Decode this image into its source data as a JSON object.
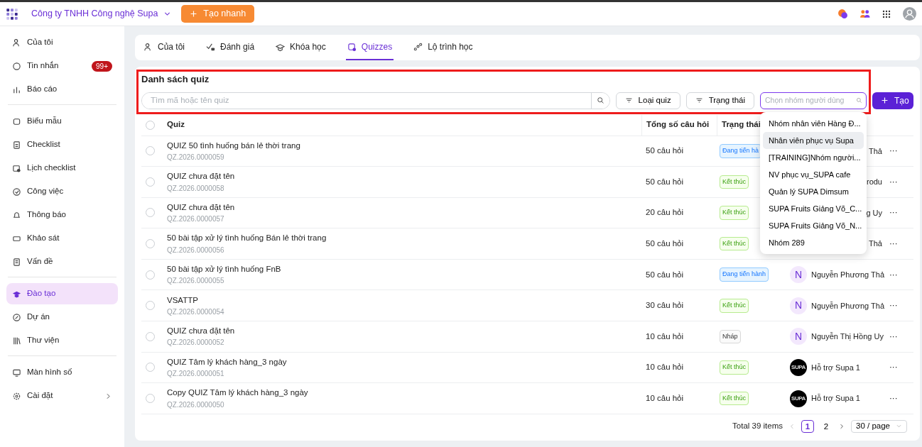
{
  "topbar": {
    "company": "Công ty TNHH Công nghệ Supa",
    "quick_create": "Tạo nhanh"
  },
  "sidebar": {
    "groups": [
      [
        {
          "label": "Của tôi",
          "selected": false
        },
        {
          "label": "Tin nhắn",
          "badge": "99+",
          "selected": false
        },
        {
          "label": "Báo cáo",
          "selected": false
        }
      ],
      [
        {
          "label": "Biểu mẫu",
          "selected": false
        },
        {
          "label": "Checklist",
          "selected": false
        },
        {
          "label": "Lịch checklist",
          "selected": false
        },
        {
          "label": "Công việc",
          "selected": false
        },
        {
          "label": "Thông báo",
          "selected": false
        },
        {
          "label": "Khảo sát",
          "selected": false
        },
        {
          "label": "Vấn đề",
          "selected": false
        }
      ],
      [
        {
          "label": "Đào tạo",
          "selected": true
        },
        {
          "label": "Dự án",
          "selected": false
        },
        {
          "label": "Thư viện",
          "selected": false
        }
      ],
      [
        {
          "label": "Màn hình số",
          "selected": false
        },
        {
          "label": "Cài đặt",
          "selected": false,
          "expandable": true
        }
      ]
    ]
  },
  "tabs": [
    {
      "label": "Của tôi",
      "selected": false
    },
    {
      "label": "Đánh giá",
      "selected": false
    },
    {
      "label": "Khóa học",
      "selected": false
    },
    {
      "label": "Quizzes",
      "selected": true
    },
    {
      "label": "Lộ trình học",
      "selected": false
    }
  ],
  "panel": {
    "title": "Danh sách quiz",
    "search": {
      "placeholder": "Tìm mã hoặc tên quiz"
    },
    "filters": [
      "Loại quiz",
      "Trạng thái"
    ],
    "group_select": {
      "placeholder": "Chọn nhóm người dùng",
      "focused": true,
      "options": [
        {
          "label": "Nhóm nhân viên Hàng Đ...",
          "highlighted": false
        },
        {
          "label": "Nhân viên phục vụ Supa",
          "highlighted": true
        },
        {
          "label": "[TRAINING]Nhóm người...",
          "highlighted": false
        },
        {
          "label": "NV phục vụ_SUPA cafe",
          "highlighted": false
        },
        {
          "label": "Quản lý SUPA Dimsum",
          "highlighted": false
        },
        {
          "label": "SUPA Fruits Giảng Võ_C...",
          "highlighted": false
        },
        {
          "label": "SUPA Fruits Giảng Võ_N...",
          "highlighted": false
        },
        {
          "label": "Nhóm 289",
          "highlighted": false
        }
      ]
    },
    "create": "Tạo"
  },
  "table": {
    "select_all_checked": false,
    "columns": [
      "Quiz",
      "Tổng số câu hỏi",
      "Trạng thái"
    ],
    "rows": [
      {
        "checked": false,
        "name": "QUIZ 50 tình huống bán lẻ thời trang",
        "code": "QZ.2026.0000059",
        "total": "50 câu hỏi",
        "status": {
          "kind": "in_progress",
          "label": "Đang tiến hà"
        },
        "creator": {
          "name": "Thả"
        },
        "more": "···"
      },
      {
        "checked": false,
        "name": "QUIZ chưa đặt tên",
        "code": "QZ.2026.0000058",
        "total": "50 câu hỏi",
        "status": {
          "kind": "done",
          "label": "Kết thúc"
        },
        "creator": {
          "name": "rodu"
        },
        "more": "···"
      },
      {
        "checked": false,
        "name": "QUIZ chưa đặt tên",
        "code": "QZ.2026.0000057",
        "total": "20 câu hỏi",
        "status": {
          "kind": "done",
          "label": "Kết thúc"
        },
        "creator": {
          "name": "g Uy"
        },
        "more": "···"
      },
      {
        "checked": false,
        "name": "50 bài tập xử lý tình huống Bán lẻ thời trang",
        "code": "QZ.2026.0000056",
        "total": "50 câu hỏi",
        "status": {
          "kind": "done",
          "label": "Kết thúc"
        },
        "creator": {
          "name": "Thả"
        },
        "more": "···"
      },
      {
        "checked": false,
        "name": "50 bài tập xử lý tình huống FnB",
        "code": "QZ.2026.0000055",
        "total": "50 câu hỏi",
        "status": {
          "kind": "in_progress",
          "label": "Đang tiến hành"
        },
        "creator": {
          "avatar": {
            "kind": "letter",
            "text": "N"
          },
          "name": "Nguyễn Phương Thả"
        },
        "more": "···"
      },
      {
        "checked": false,
        "name": "VSATTP",
        "code": "QZ.2026.0000054",
        "total": "30 câu hỏi",
        "status": {
          "kind": "done",
          "label": "Kết thúc"
        },
        "creator": {
          "avatar": {
            "kind": "letter",
            "text": "N"
          },
          "name": "Nguyễn Phương Thả"
        },
        "more": "···"
      },
      {
        "checked": false,
        "name": "QUIZ chưa đặt tên",
        "code": "QZ.2026.0000052",
        "total": "10 câu hỏi",
        "status": {
          "kind": "draft",
          "label": "Nháp"
        },
        "creator": {
          "avatar": {
            "kind": "letter",
            "text": "N"
          },
          "name": "Nguyễn Thị Hồng Uy"
        },
        "more": "···"
      },
      {
        "checked": false,
        "name": "QUIZ Tâm lý khách hàng_3 ngày",
        "code": "QZ.2026.0000051",
        "total": "10 câu hỏi",
        "status": {
          "kind": "done",
          "label": "Kết thúc"
        },
        "creator": {
          "avatar": {
            "kind": "logo",
            "text": "SUPA"
          },
          "name": "Hỗ trợ Supa 1"
        },
        "more": "···"
      },
      {
        "checked": false,
        "name": "Copy QUIZ Tâm lý khách hàng_3 ngày",
        "code": "QZ.2026.0000050",
        "total": "10 câu hỏi",
        "status": {
          "kind": "done",
          "label": "Kết thúc"
        },
        "creator": {
          "avatar": {
            "kind": "logo",
            "text": "SUPA"
          },
          "name": "Hỗ trợ Supa 1"
        },
        "more": "···"
      }
    ]
  },
  "pagination": {
    "total": "Total 39 items",
    "pages": [
      {
        "label": "1",
        "selected": true
      },
      {
        "label": "2",
        "selected": false
      }
    ],
    "page_size": "30 / page"
  }
}
